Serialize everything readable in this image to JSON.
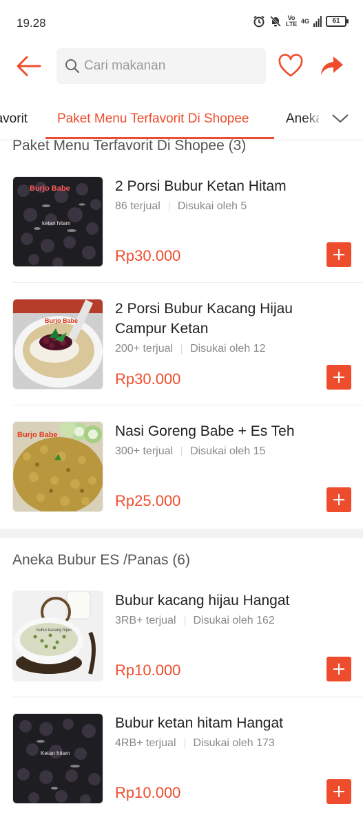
{
  "status_bar": {
    "time": "19.28",
    "network_volte": "Vo LTE",
    "network_type": "4G",
    "battery": "61"
  },
  "header": {
    "search_placeholder": "Cari makanan"
  },
  "tabs": {
    "prev_partial": "Favorit",
    "active": "Paket Menu Terfavorit Di Shopee",
    "next_partial": "Aneka Bubur ES /Panas"
  },
  "sections": [
    {
      "title": "Paket Menu Terfavorit Di Shopee (3)",
      "items": [
        {
          "name": "2 Porsi Bubur Ketan Hitam",
          "sold": "86 terjual",
          "likes": "Disukai oleh 5",
          "price": "Rp30.000",
          "image_caption": "Burjo Babe",
          "image_sub_caption": "ketan hitam"
        },
        {
          "name": "2 Porsi Bubur Kacang Hijau Campur Ketan",
          "sold": "200+ terjual",
          "likes": "Disukai oleh 12",
          "price": "Rp30.000",
          "image_caption": "Burjo Babe"
        },
        {
          "name": "Nasi Goreng Babe + Es Teh",
          "sold": "300+ terjual",
          "likes": "Disukai oleh 15",
          "price": "Rp25.000",
          "image_caption": "Burjo Babe"
        }
      ]
    },
    {
      "title": "Aneka Bubur ES /Panas (6)",
      "items": [
        {
          "name": "Bubur kacang hijau Hangat",
          "sold": "3RB+ terjual",
          "likes": "Disukai oleh 162",
          "price": "Rp10.000",
          "image_caption": "bubur kacang hijau"
        },
        {
          "name": "Bubur ketan hitam Hangat",
          "sold": "4RB+ terjual",
          "likes": "Disukai oleh 173",
          "price": "Rp10.000",
          "image_caption": "Ketan hitam"
        }
      ]
    }
  ],
  "colors": {
    "brand": "#ee4d2d",
    "text": "#222222",
    "muted": "#888888",
    "divider": "#f2f2f2"
  },
  "icons": [
    "arrow-left-icon",
    "search-icon",
    "heart-icon",
    "share-icon",
    "chevron-down-icon",
    "plus-icon",
    "alarm-icon",
    "bell-off-icon",
    "signal-icon",
    "battery-icon"
  ]
}
